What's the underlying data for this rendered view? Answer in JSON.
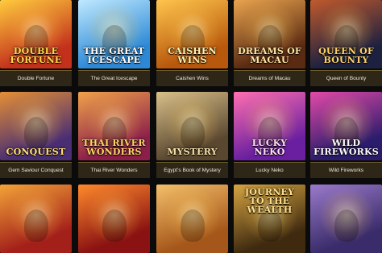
{
  "games": [
    {
      "title": "Double Fortune",
      "logo": "Double Fortune",
      "colors": [
        "#c3311c",
        "#ffcb3d"
      ],
      "logo_color": "#ffd84a"
    },
    {
      "title": "The Great Icescape",
      "logo": "The Great Icescape",
      "colors": [
        "#2d89d6",
        "#bfe9ff"
      ],
      "logo_color": "#ffffff"
    },
    {
      "title": "Caishen Wins",
      "logo": "Caishen Wins",
      "colors": [
        "#b8580c",
        "#ffc54d"
      ],
      "logo_color": "#fff2b0"
    },
    {
      "title": "Dreams of Macau",
      "logo": "Dreams of Macau",
      "colors": [
        "#5a2a12",
        "#e9a44e"
      ],
      "logo_color": "#ffe7a6"
    },
    {
      "title": "Queen of Bounty",
      "logo": "Queen of Bounty",
      "colors": [
        "#1d2140",
        "#c05a2c"
      ],
      "logo_color": "#ffd36a"
    },
    {
      "title": "Gem Saviour Conquest",
      "logo": "Conquest",
      "colors": [
        "#4a2e73",
        "#e58f34"
      ],
      "logo_color": "#ffe16a"
    },
    {
      "title": "Thai River Wonders",
      "logo": "Thai River Wonders",
      "colors": [
        "#8b1f4a",
        "#f0a24a"
      ],
      "logo_color": "#ffd764"
    },
    {
      "title": "Egypt's Book of Mystery",
      "logo": "Mystery",
      "colors": [
        "#5a4730",
        "#d9c08a"
      ],
      "logo_color": "#f6e2a8"
    },
    {
      "title": "Lucky Neko",
      "logo": "Lucky Neko",
      "colors": [
        "#6a1fa0",
        "#ff6fb0"
      ],
      "logo_color": "#ffe2f6"
    },
    {
      "title": "Wild Fireworks",
      "logo": "Wild Fireworks",
      "colors": [
        "#2b1c6c",
        "#e34aa8"
      ],
      "logo_color": "#ffffff"
    },
    {
      "title": "",
      "logo": "",
      "colors": [
        "#a31f1a",
        "#f3a338"
      ],
      "logo_color": "#ffd24a"
    },
    {
      "title": "",
      "logo": "",
      "colors": [
        "#8a1212",
        "#ff8a2c"
      ],
      "logo_color": "#ffd24a"
    },
    {
      "title": "",
      "logo": "",
      "colors": [
        "#a5561a",
        "#f4c06a"
      ],
      "logo_color": "#ffe7a6"
    },
    {
      "title": "",
      "logo": "Journey to the Wealth",
      "colors": [
        "#3f2a10",
        "#d6a542"
      ],
      "logo_color": "#ffe08a"
    },
    {
      "title": "",
      "logo": "",
      "colors": [
        "#3a2c6a",
        "#9a7acb"
      ],
      "logo_color": "#ffe08a"
    }
  ]
}
